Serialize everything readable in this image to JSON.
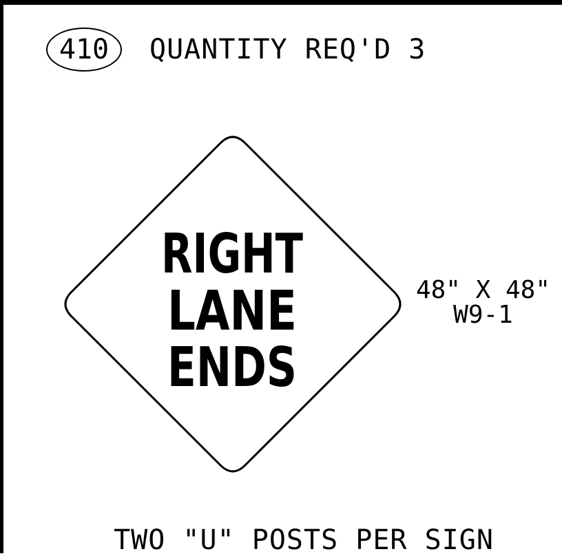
{
  "item_number": "410",
  "quantity_label": "QUANTITY REQ'D 3",
  "sign": {
    "legend": [
      "RIGHT",
      "LANE",
      "ENDS"
    ],
    "size": "48\" X 48\"",
    "code": "W9-1"
  },
  "posts_note": "TWO \"U\" POSTS PER SIGN",
  "colors": {
    "background": "#ffffff",
    "ink": "#000000"
  }
}
